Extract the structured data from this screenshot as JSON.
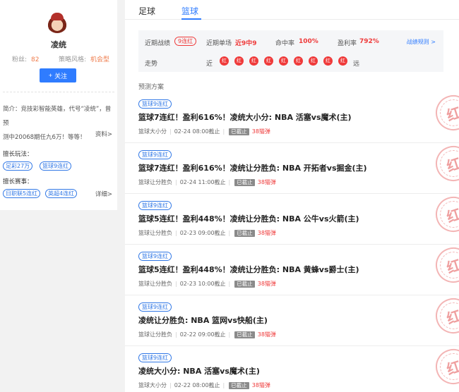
{
  "profile": {
    "name": "凌统",
    "fans_label": "粉丝:",
    "fans_value": "82",
    "style_label": "策略风格:",
    "style_value": "机会型",
    "follow_label": "关注",
    "intro_line1": "简介：竞技彩智能英雄，代号“凌统”，曾预",
    "intro_line2": "测中20068期任九6万！等等！",
    "more_label": "资料>",
    "play_label": "擅长玩法：",
    "play_tags": [
      "足彩27万",
      "篮球9连红"
    ],
    "event_label": "擅长赛事：",
    "event_tags": [
      "日职联5连红",
      "英超4连红"
    ],
    "detail_label": "详细>",
    "colors": {
      "accent": "#2f7cff",
      "orange": "#ef7b4b"
    }
  },
  "tabs": [
    {
      "label": "足球",
      "active": false
    },
    {
      "label": "篮球",
      "active": true
    }
  ],
  "summary": {
    "recent_label": "近期战绩",
    "recent_badge": "9连红",
    "single_label": "近期单场",
    "single_value": "近9中9",
    "hit_label": "命中率",
    "hit_value": "100%",
    "profit_label": "盈利率",
    "profit_value": "792%",
    "rule_link": "战绩规则 >",
    "trend_label": "走势",
    "trend_near": "近",
    "trend_far": "远",
    "trend": [
      "红",
      "红",
      "红",
      "红",
      "红",
      "红",
      "红",
      "红",
      "红"
    ],
    "colors": {
      "red": "#ef3a3a"
    }
  },
  "section_title": "预测方案",
  "items": [
    {
      "tag": "篮球9连红",
      "title": "篮球7连红！盈利616%！凌统大小分: NBA 活塞vs魔术(主)",
      "category": "篮球大小分",
      "deadline": "02-24 08:00截止",
      "status": "已截止",
      "price": "38猫弹",
      "stamp": "红"
    },
    {
      "tag": "篮球9连红",
      "title": "篮球7连红！盈利616%！凌统让分胜负: NBA 开拓者vs掘金(主)",
      "category": "篮球让分胜负",
      "deadline": "02-24 11:00截止",
      "status": "已截止",
      "price": "38猫弹",
      "stamp": "红"
    },
    {
      "tag": "篮球9连红",
      "title": "篮球5连红！盈利448%！凌统让分胜负: NBA 公牛vs火箭(主)",
      "category": "篮球让分胜负",
      "deadline": "02-23 09:00截止",
      "status": "已截止",
      "price": "38猫弹",
      "stamp": "红"
    },
    {
      "tag": "篮球9连红",
      "title": "篮球5连红！盈利448%！凌统让分胜负: NBA 黄蜂vs爵士(主)",
      "category": "篮球让分胜负",
      "deadline": "02-23 10:00截止",
      "status": "已截止",
      "price": "38猫弹",
      "stamp": "红"
    },
    {
      "tag": "篮球9连红",
      "title": "凌统让分胜负: NBA 篮网vs快船(主)",
      "category": "篮球让分胜负",
      "deadline": "02-22 09:00截止",
      "status": "已截止",
      "price": "38猫弹",
      "stamp": "红"
    },
    {
      "tag": "篮球9连红",
      "title": "凌统大小分: NBA 活塞vs魔术(主)",
      "category": "篮球大小分",
      "deadline": "02-22 08:00截止",
      "status": "已截止",
      "price": "38猫弹",
      "stamp": "红"
    }
  ]
}
